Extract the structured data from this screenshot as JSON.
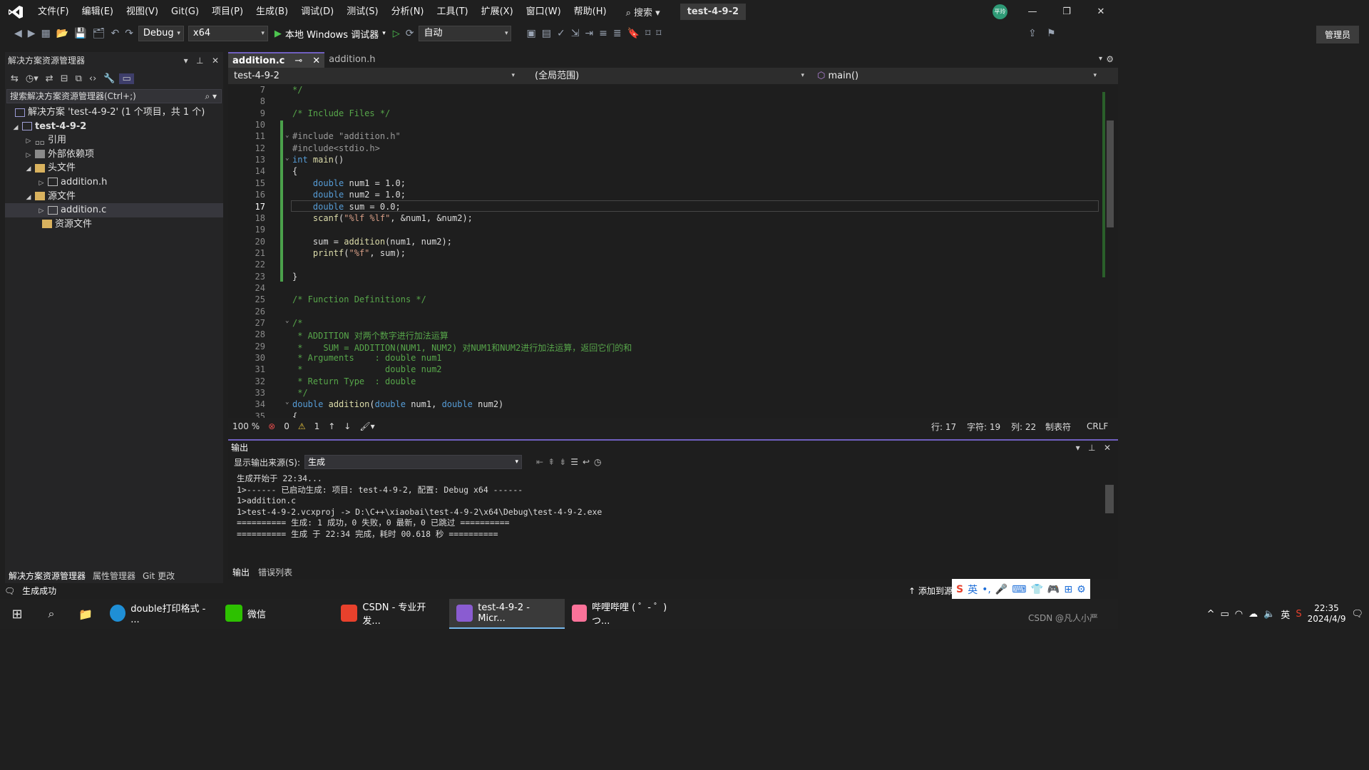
{
  "menubar": {
    "items": [
      "文件(F)",
      "编辑(E)",
      "视图(V)",
      "Git(G)",
      "项目(P)",
      "生成(B)",
      "调试(D)",
      "测试(S)",
      "分析(N)",
      "工具(T)",
      "扩展(X)",
      "窗口(W)",
      "帮助(H)"
    ],
    "search_label": "搜索",
    "solution_title": "test-4-9-2",
    "avatar_text": "平玲"
  },
  "toolbar": {
    "config": "Debug",
    "platform": "x64",
    "run_label": "本地 Windows 调试器",
    "auto_combo": "自动",
    "admin_label": "管理员"
  },
  "solution_explorer": {
    "title": "解决方案资源管理器",
    "search_placeholder": "搜索解决方案资源管理器(Ctrl+;)",
    "tree": [
      {
        "label": "解决方案 'test-4-9-2' (1 个项目，共 1 个)"
      },
      {
        "label": "test-4-9-2"
      },
      {
        "label": "引用"
      },
      {
        "label": "外部依赖项"
      },
      {
        "label": "头文件"
      },
      {
        "label": "addition.h"
      },
      {
        "label": "源文件"
      },
      {
        "label": "addition.c"
      },
      {
        "label": "资源文件"
      }
    ],
    "bottom_tabs": [
      "解决方案资源管理器",
      "属性管理器",
      "Git 更改"
    ]
  },
  "editor": {
    "tabs": [
      "addition.c",
      "addition.h"
    ],
    "nav_project": "test-4-9-2",
    "nav_scope": "(全局范围)",
    "nav_member": "main()",
    "line_numbers": [
      "7",
      "8",
      "9",
      "10",
      "11",
      "12",
      "13",
      "14",
      "15",
      "16",
      "17",
      "18",
      "19",
      "20",
      "21",
      "22",
      "23",
      "24",
      "25",
      "26",
      "27",
      "28",
      "29",
      "30",
      "31",
      "32",
      "33",
      "34",
      "35"
    ],
    "lines": [
      "*/",
      "",
      "/* Include Files */",
      "",
      "#include \"addition.h\"",
      "#include<stdio.h>",
      "int main()",
      "{",
      "    double num1 = 1.0;",
      "    double num2 = 1.0;",
      "    double sum = 0.0;",
      "    scanf(\"%lf %lf\", &num1, &num2);",
      "",
      "    sum = addition(num1, num2);",
      "    printf(\"%f\", sum);",
      "",
      "}",
      "",
      "/* Function Definitions */",
      "",
      "/*",
      " * ADDITION 对两个数字进行加法运算",
      " *    SUM = ADDITION(NUM1, NUM2) 对NUM1和NUM2进行加法运算，返回它们的和",
      " * Arguments    : double num1",
      " *                double num2",
      " * Return Type  : double",
      " */",
      "double addition(double num1, double num2)",
      "{"
    ],
    "zoom": "100 %",
    "errors": "0",
    "warnings": "1",
    "row": "行: 17",
    "char": "字符: 19",
    "col": "列: 22",
    "tab_mode": "制表符",
    "eol": "CRLF"
  },
  "output": {
    "title": "输出",
    "source_label": "显示输出来源(S):",
    "source_value": "生成",
    "text": "生成开始于 22:34...\n1>------ 已启动生成: 项目: test-4-9-2, 配置: Debug x64 ------\n1>addition.c\n1>test-4-9-2.vcxproj -> D:\\C++\\xiaobai\\test-4-9-2\\x64\\Debug\\test-4-9-2.exe\n========== 生成: 1 成功，0 失败，0 最新，0 已跳过 ==========\n========== 生成 于 22:34 完成，耗时 00.618 秒 ==========",
    "bottom_tabs": [
      "输出",
      "错误列表"
    ]
  },
  "statusbar": {
    "text": "生成成功",
    "add_source": "添加到源"
  },
  "taskbar": {
    "apps": [
      "double打印格式 - ...",
      "微信",
      "CSDN - 专业开发...",
      "test-4-9-2 - Micr...",
      "哔哩哔哩 ( ゜- ゜)つ..."
    ],
    "ime": "英",
    "time": "22:35",
    "date": "2024/4/9",
    "watermark": "CSDN @凡人小严"
  },
  "colors": {
    "accent": "#7060c0",
    "green": "#4dc54f",
    "bg": "#1f1f1f"
  }
}
